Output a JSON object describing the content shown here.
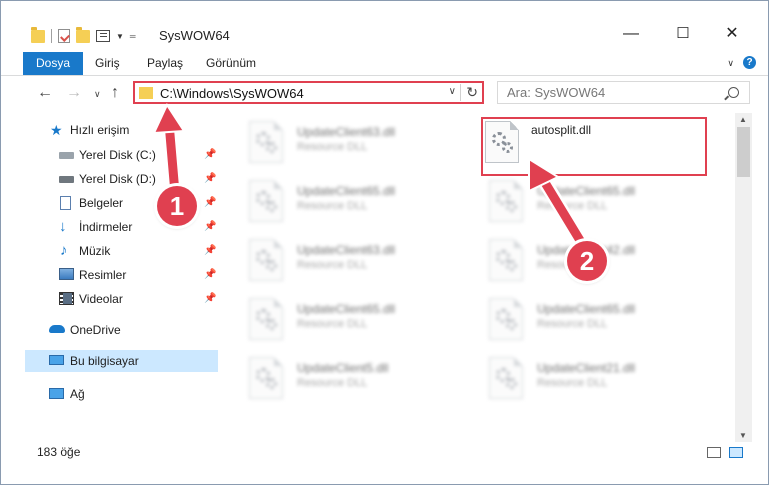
{
  "window": {
    "title": "SysWOW64",
    "controls": {
      "minimize": "—",
      "maximize": "☐",
      "close": "✕"
    }
  },
  "ribbon": {
    "tabs": [
      "Dosya",
      "Giriş",
      "Paylaş",
      "Görünüm"
    ],
    "help": "?"
  },
  "address": {
    "path": "C:\\Windows\\SysWOW64",
    "search_placeholder": "Ara: SysWOW64"
  },
  "sidebar": {
    "quick_access": "Hızlı erişim",
    "items": [
      {
        "label": "Yerel Disk (C:)",
        "icon": "drive-icon",
        "pinned": true
      },
      {
        "label": "Yerel Disk (D:)",
        "icon": "drive-icon",
        "pinned": true
      },
      {
        "label": "Belgeler",
        "icon": "documents-icon",
        "pinned": true
      },
      {
        "label": "İndirmeler",
        "icon": "downloads-icon",
        "pinned": true
      },
      {
        "label": "Müzik",
        "icon": "music-icon",
        "pinned": true
      },
      {
        "label": "Resimler",
        "icon": "pictures-icon",
        "pinned": true
      },
      {
        "label": "Videolar",
        "icon": "videos-icon",
        "pinned": true
      }
    ],
    "onedrive": "OneDrive",
    "this_pc": "Bu bilgisayar",
    "network": "Ağ"
  },
  "files": {
    "left_column": [
      {
        "name": "UpdateClient63.dll",
        "type": "Resource DLL"
      },
      {
        "name": "UpdateClient65.dll",
        "type": "Resource DLL"
      },
      {
        "name": "UpdateClient63.dll",
        "type": "Resource DLL"
      },
      {
        "name": "UpdateClient65.dll",
        "type": "Resource DLL"
      },
      {
        "name": "UpdateClient5.dll",
        "type": "Resource DLL"
      }
    ],
    "right_column": [
      {
        "name": "autosplit.dll",
        "type": ""
      },
      {
        "name": "UpdateClient65.dll",
        "type": "Resource DLL"
      },
      {
        "name": "UpdateClient42.dll",
        "type": "Resource DLL"
      },
      {
        "name": "UpdateClient65.dll",
        "type": "Resource DLL"
      },
      {
        "name": "UpdateClient21.dll",
        "type": "Resource DLL"
      }
    ]
  },
  "status": {
    "item_count": "183 öğe"
  },
  "callouts": {
    "one": "1",
    "two": "2",
    "color": "#e04050"
  }
}
